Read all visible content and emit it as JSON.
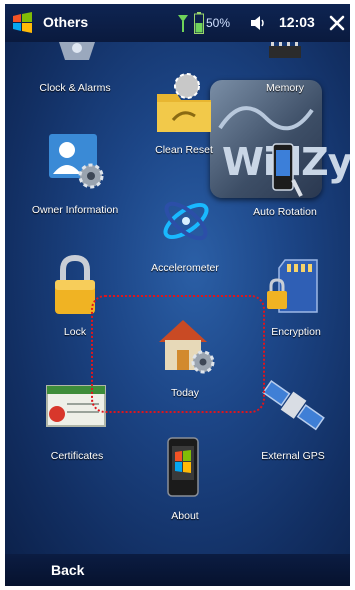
{
  "status_bar": {
    "title": "Others",
    "battery": "50%",
    "time": "12:03",
    "icons": [
      "start-icon",
      "signal-icon",
      "battery-icon",
      "volume-icon",
      "close-icon"
    ]
  },
  "items": {
    "clock": "Clock & Alarms",
    "memory": "Memory",
    "clean_reset": "Clean Reset",
    "owner": "Owner Information",
    "auto_rotation": "Auto Rotation",
    "accelerometer": "Accelerometer",
    "lock": "Lock",
    "encryption": "Encryption",
    "today": "Today",
    "certificates": "Certificates",
    "external_gps": "External GPS",
    "about": "About"
  },
  "widget": {
    "text": "WidZy"
  },
  "softkeys": {
    "left": "Back"
  },
  "colors": {
    "background": "#1c4586",
    "selection_outline": "#e0151b",
    "text": "#ffffff"
  }
}
